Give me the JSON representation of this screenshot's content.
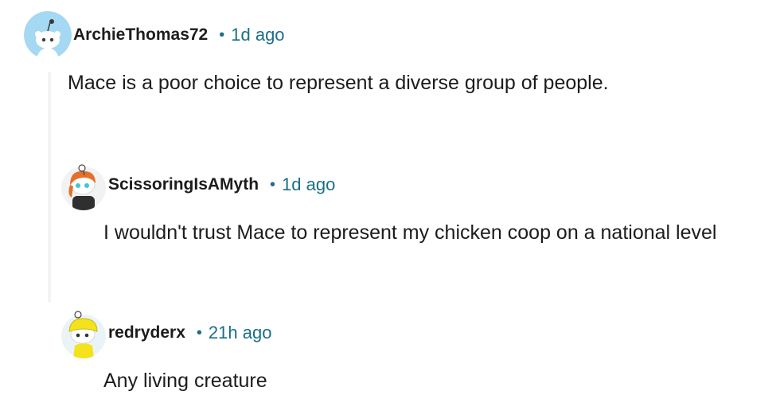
{
  "comments": [
    {
      "author": "ArchieThomas72",
      "separator": "•",
      "time": "1d ago",
      "text": "Mace is a poor choice to represent a diverse group of people."
    },
    {
      "author": "ScissoringIsAMyth",
      "separator": "•",
      "time": "1d ago",
      "text": "I wouldn't trust Mace to represent my chicken coop on a national level"
    },
    {
      "author": "redryderx",
      "separator": "•",
      "time": "21h ago",
      "text": "Any living creature"
    }
  ],
  "colors": {
    "timestamp": "#1a6f86",
    "author": "#1c1c1c",
    "avatar_bg": "#a5d8f3"
  },
  "icons": [
    "default-snoo-avatar-icon",
    "orange-hair-snoo-avatar-icon",
    "yellow-hat-snoo-avatar-icon"
  ]
}
